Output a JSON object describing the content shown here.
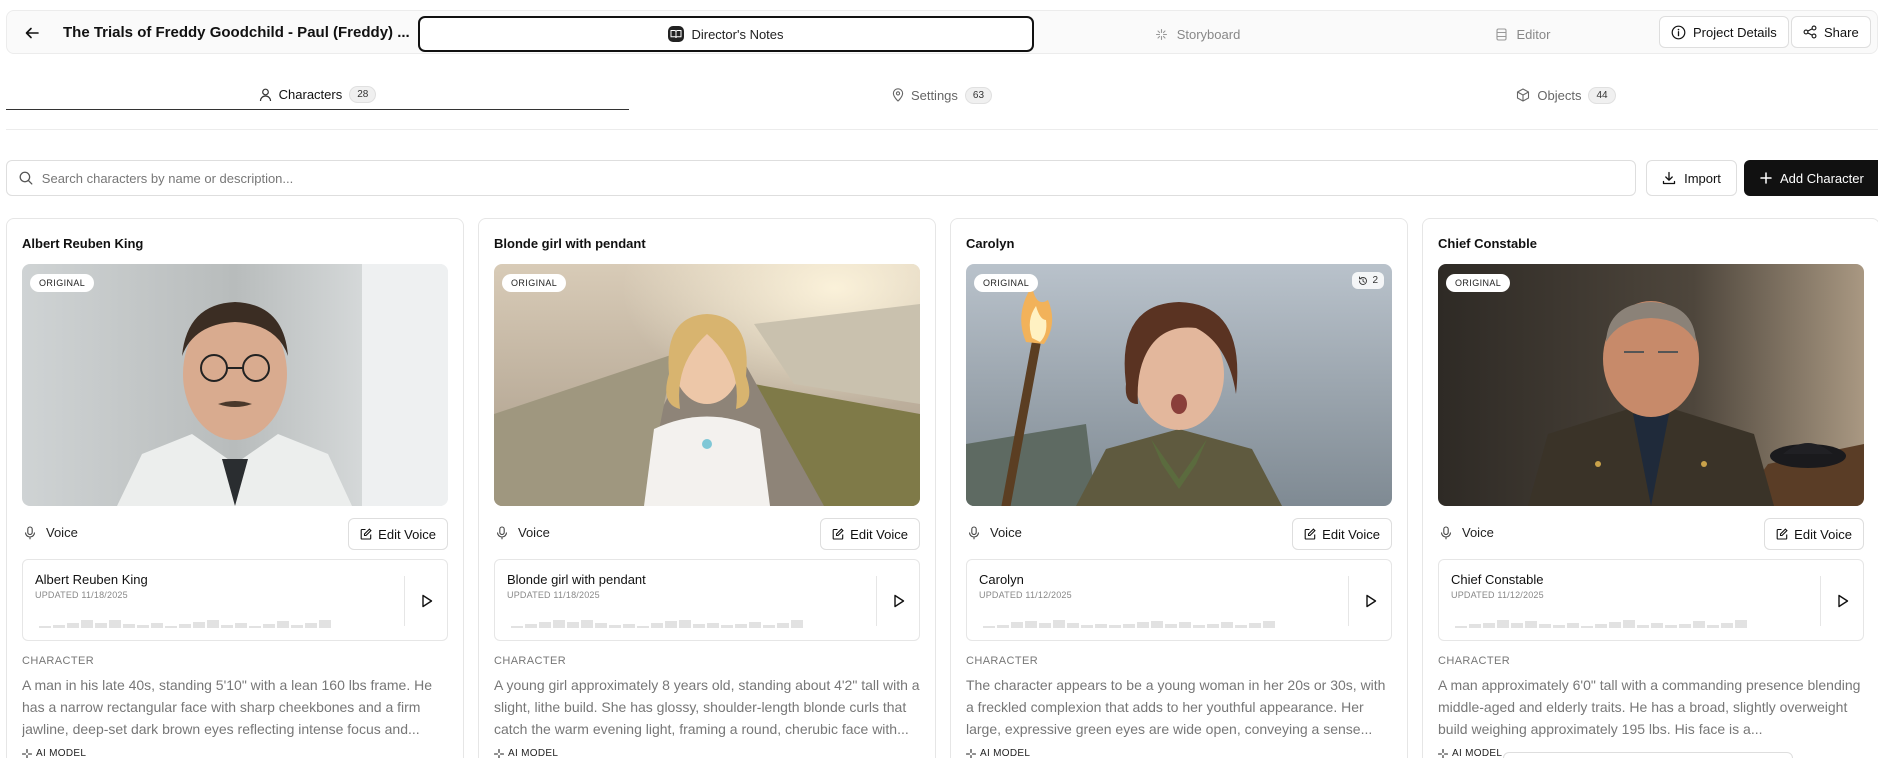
{
  "header": {
    "title": "The Trials of Freddy Goodchild - Paul (Freddy) ...",
    "modes": [
      {
        "label": "Director's Notes",
        "icon": "book-icon",
        "active": true
      },
      {
        "label": "Storyboard",
        "icon": "sparkle-icon",
        "active": false
      },
      {
        "label": "Editor",
        "icon": "film-icon",
        "active": false
      }
    ],
    "actions": {
      "project_details": "Project Details",
      "share": "Share"
    }
  },
  "tabs": [
    {
      "label": "Characters",
      "count": "28",
      "icon": "user-icon",
      "active": true
    },
    {
      "label": "Settings",
      "count": "63",
      "icon": "map-pin-icon",
      "active": false
    },
    {
      "label": "Objects",
      "count": "44",
      "icon": "box-icon",
      "active": false
    }
  ],
  "search": {
    "placeholder": "Search characters by name or description...",
    "value": ""
  },
  "toolbar": {
    "import_label": "Import",
    "add_label": "Add Character"
  },
  "labels": {
    "original": "ORIGINAL",
    "voice": "Voice",
    "edit_voice": "Edit Voice",
    "character": "CHARACTER",
    "ai_model": "AI MODEL"
  },
  "characters": [
    {
      "name": "Albert Reuben King",
      "voice_name": "Albert Reuben King",
      "updated": "UPDATED 11/18/2025",
      "versions": "",
      "description": "A man in his late 40s, standing 5'10\" with a lean 160 lbs frame. He has a narrow rectangular face with sharp cheekbones and a firm jawline, deep-set dark brown eyes reflecting intense focus and..."
    },
    {
      "name": "Blonde girl with pendant",
      "voice_name": "Blonde girl with pendant",
      "updated": "UPDATED 11/18/2025",
      "versions": "",
      "description": "A young girl approximately 8 years old, standing about 4'2\" tall with a slight, lithe build. She has glossy, shoulder-length blonde curls that catch the warm evening light, framing a round, cherubic face with..."
    },
    {
      "name": "Carolyn",
      "voice_name": "Carolyn",
      "updated": "UPDATED 11/12/2025",
      "versions": "2",
      "description": "The character appears to be a young woman in her 20s or 30s, with a freckled complexion that adds to her youthful appearance. Her large, expressive green eyes are wide open, conveying a sense..."
    },
    {
      "name": "Chief Constable",
      "voice_name": "Chief Constable",
      "updated": "UPDATED 11/12/2025",
      "versions": "",
      "description": "A man approximately 6'0\" tall with a commanding presence blending middle-aged and elderly traits. He has a broad, slightly overweight build weighing approximately 195 lbs. His face is a..."
    }
  ],
  "colors": {
    "primary_button": "#111111",
    "border": "#dedede",
    "muted_text": "#777777"
  }
}
